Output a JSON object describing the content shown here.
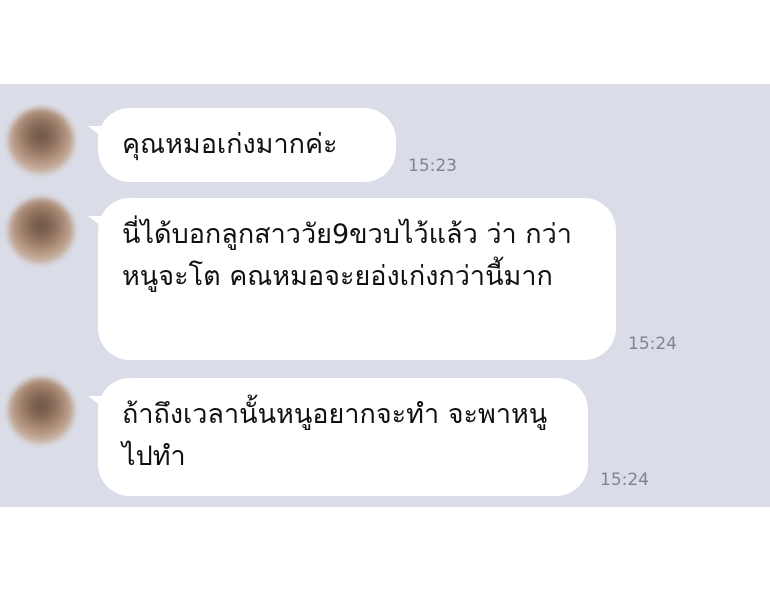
{
  "messages": [
    {
      "text": "คุณหมอเก่งมากค่ะ",
      "time": "15:23"
    },
    {
      "text": "นี่ได้บอกลูกสาววัย9ขวบไว้แล้ว ว่า กว่าหนูจะโต คณหมอจะยอ่งเก่งกว่านี้มาก",
      "time": "15:24"
    },
    {
      "text": "ถ้าถึงเวลานั้นหนูอยากจะทำ จะพาหนูไปทำ",
      "time": "15:24"
    }
  ],
  "colors": {
    "chat_background": "#dadde8",
    "bubble": "#ffffff",
    "timestamp": "#7c8494",
    "text": "#111111"
  }
}
